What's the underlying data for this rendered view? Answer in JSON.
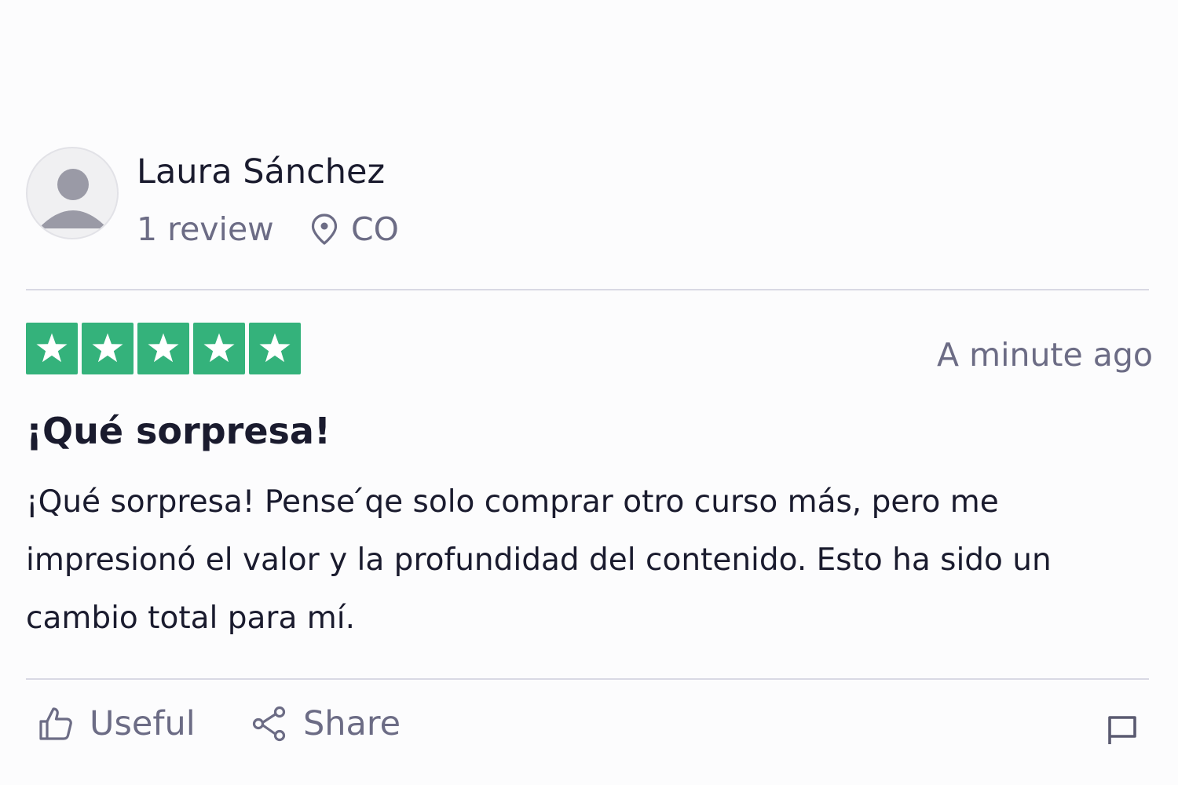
{
  "reviewer": {
    "name": "Laura Sánchez",
    "review_count": "1 review",
    "location": "CO",
    "avatar_icon": "user-silhouette-icon",
    "location_icon": "map-pin-icon"
  },
  "review": {
    "rating": 5,
    "rating_max": 5,
    "star_color": "#34b27b",
    "date": "A minute ago",
    "title": "¡Qué sorpresa!",
    "body": "¡Qué sorpresa! Pense ́qe solo comprar otro curso más, pero me impresionó el valor y la profundidad del contenido. Esto ha sido un cambio total para mí."
  },
  "actions": {
    "useful_label": "Useful",
    "useful_icon": "thumbs-up-icon",
    "share_label": "Share",
    "share_icon": "share-icon",
    "report_icon": "flag-icon"
  },
  "colors": {
    "text_primary": "#1a1b2e",
    "text_secondary": "#6c6c85",
    "divider": "#d9d9e4",
    "background": "#fcfcfd"
  }
}
